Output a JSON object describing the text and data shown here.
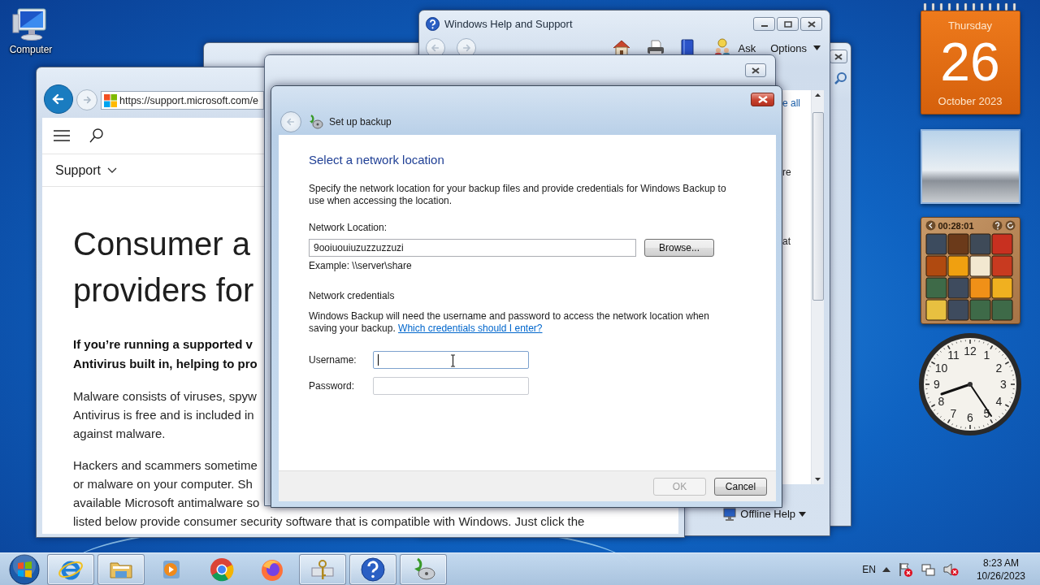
{
  "desktop_icons": [
    {
      "label": "Computer"
    }
  ],
  "browser": {
    "url": "https://support.microsoft.com/e",
    "nav_label": "Support",
    "heading_lines": [
      "Consumer a",
      "providers for"
    ],
    "paragraphs": [
      {
        "kind": "bold",
        "lines": [
          "If you’re running a supported v",
          "Antivirus built in, helping to pro"
        ]
      },
      {
        "kind": "normal",
        "lines": [
          "Malware consists of viruses, spyw",
          "Antivirus is free and is included in",
          "against malware."
        ]
      },
      {
        "kind": "normal",
        "lines": [
          "Hackers and scammers sometime",
          "or malware on your computer. Sh",
          "available Microsoft antimalware so",
          "listed below provide consumer security software that is compatible with Windows. Just click the"
        ]
      }
    ]
  },
  "help_window": {
    "title": "Windows Help and Support",
    "ask": "Ask",
    "options": "Options",
    "snippets": [
      {
        "kind": "link",
        "text": "e all"
      },
      {
        "kind": "text",
        "text": "re"
      },
      {
        "kind": "text",
        "text": "at"
      }
    ],
    "footer": "Offline Help"
  },
  "backup_dialog": {
    "title": "Set up backup",
    "heading": "Select a network location",
    "description": "Specify the network location for your backup files and provide credentials for Windows Backup to use when accessing the location.",
    "location_label": "Network Location:",
    "location_value": "9ooiuouiuzuzzuzzuzi",
    "browse_button": "Browse...",
    "example": "Example: \\\\server\\share",
    "credentials_heading": "Network credentials",
    "credentials_text": "Windows Backup will need the username and password to access the network location when saving your backup.",
    "credentials_link": "Which credentials should I enter?",
    "fields": [
      {
        "label": "Username:",
        "focused": true
      },
      {
        "label": "Password:",
        "focused": false
      }
    ],
    "buttons": [
      {
        "label": "OK",
        "disabled": true
      },
      {
        "label": "Cancel",
        "disabled": false
      }
    ]
  },
  "gadgets": {
    "calendar": {
      "weekday": "Thursday",
      "day": "26",
      "month_year": "October 2023"
    },
    "puzzle": {
      "timer": "00:28:01"
    },
    "clock": {
      "numerals": [
        "12",
        "11",
        "1",
        "10",
        "2",
        "9",
        "3",
        "8",
        "4",
        "7",
        "5",
        "6"
      ]
    }
  },
  "taskbar": {
    "items": [
      {
        "kind": "ie",
        "running": true
      },
      {
        "kind": "explorer",
        "running": true
      },
      {
        "kind": "media",
        "running": false
      },
      {
        "kind": "chrome",
        "running": false
      },
      {
        "kind": "firefox",
        "running": false
      },
      {
        "kind": "keys",
        "running": true
      },
      {
        "kind": "help",
        "running": true
      },
      {
        "kind": "backup",
        "running": true
      }
    ],
    "tray": {
      "language": "EN",
      "time": "8:23 AM",
      "date": "10/26/2023"
    }
  }
}
